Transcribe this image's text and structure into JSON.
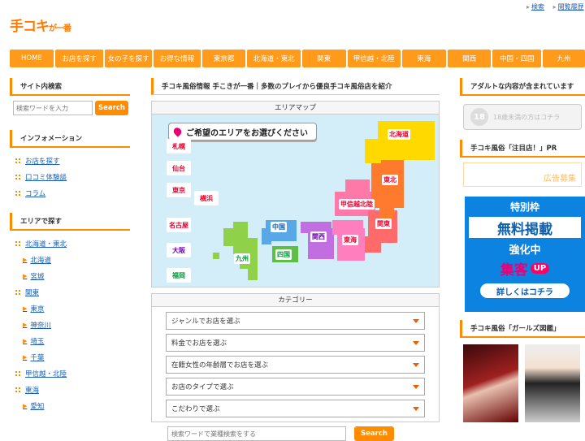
{
  "header": {
    "logo": "手コキ",
    "logo_small": "が一番",
    "links": [
      "検索",
      "閲覧履歴"
    ]
  },
  "nav": [
    "HOME",
    "お店を探す",
    "女の子を探す",
    "お得な情報",
    "東京都",
    "北海道・東北",
    "関東",
    "甲信越・北陸",
    "東海",
    "関西",
    "中国・四国",
    "九州"
  ],
  "left": {
    "search_head": "サイト内検索",
    "search_placeholder": "検索ワードを入力",
    "search_btn": "Search",
    "info_head": "インフォメーション",
    "info_links": [
      "お店を探す",
      "口コミ体験談",
      "コラム"
    ],
    "area_head": "エリアで探す",
    "area_links": [
      {
        "t": "北海道・東北",
        "sub": false
      },
      {
        "t": "北海道",
        "sub": true
      },
      {
        "t": "宮城",
        "sub": true
      },
      {
        "t": "関東",
        "sub": false
      },
      {
        "t": "東京",
        "sub": true
      },
      {
        "t": "神奈川",
        "sub": true
      },
      {
        "t": "埼玉",
        "sub": true
      },
      {
        "t": "千葉",
        "sub": true
      },
      {
        "t": "甲信越・北陸",
        "sub": false
      },
      {
        "t": "東海",
        "sub": false
      },
      {
        "t": "愛知",
        "sub": true
      }
    ]
  },
  "center": {
    "title": "手コキ風俗情報 手こきが一番｜多数のプレイから優良手コキ風俗店を紹介",
    "map_head": "エリアマップ",
    "map_banner": "ご希望のエリアをお選びください",
    "cities": [
      {
        "t": "札幌",
        "c": "#e8002d"
      },
      {
        "t": "仙台",
        "c": "#e8002d"
      },
      {
        "t": "東京",
        "c": "#e8002d"
      },
      {
        "t": "横浜",
        "c": "#e8002d"
      },
      {
        "t": "名古屋",
        "c": "#e8002d"
      },
      {
        "t": "大阪",
        "c": "#6a00b0"
      },
      {
        "t": "福岡",
        "c": "#009a3a"
      }
    ],
    "regions": {
      "hokkaido": "北海道",
      "tohoku": "東北",
      "koshinetsu": "甲信越北陸",
      "kanto": "関東",
      "tokai": "東海",
      "kansai": "関西",
      "chugoku": "中国",
      "shikoku": "四国",
      "kyushu": "九州"
    },
    "cat_head": "カテゴリー",
    "selects": [
      "ジャンルでお店を選ぶ",
      "料金でお店を選ぶ",
      "在籍女性の年齢層でお店を選ぶ",
      "お店のタイプで選ぶ",
      "こだわりで選ぶ"
    ],
    "bottom_placeholder": "検索ワードで業種検索をする",
    "bottom_btn": "Search"
  },
  "right": {
    "adult_head": "アダルトな内容が含まれています",
    "age_btn": "18歳未満の方はコチラ",
    "age_icon": "18",
    "pr_head": "手コキ風俗「注目店！」PR",
    "ad_text": "広告募集",
    "pr_banner": {
      "t1": "特別枠",
      "t2": "無料掲載",
      "t3": "強化中",
      "t4": "集客",
      "t4b": "UP",
      "t5": "詳しくはコチラ"
    },
    "girls_head": "手コキ風俗「ガールズ図鑑」"
  },
  "colors": {
    "accent": "#ff8c00",
    "nav": "#ff9a1a",
    "link": "#1a5fb4"
  }
}
